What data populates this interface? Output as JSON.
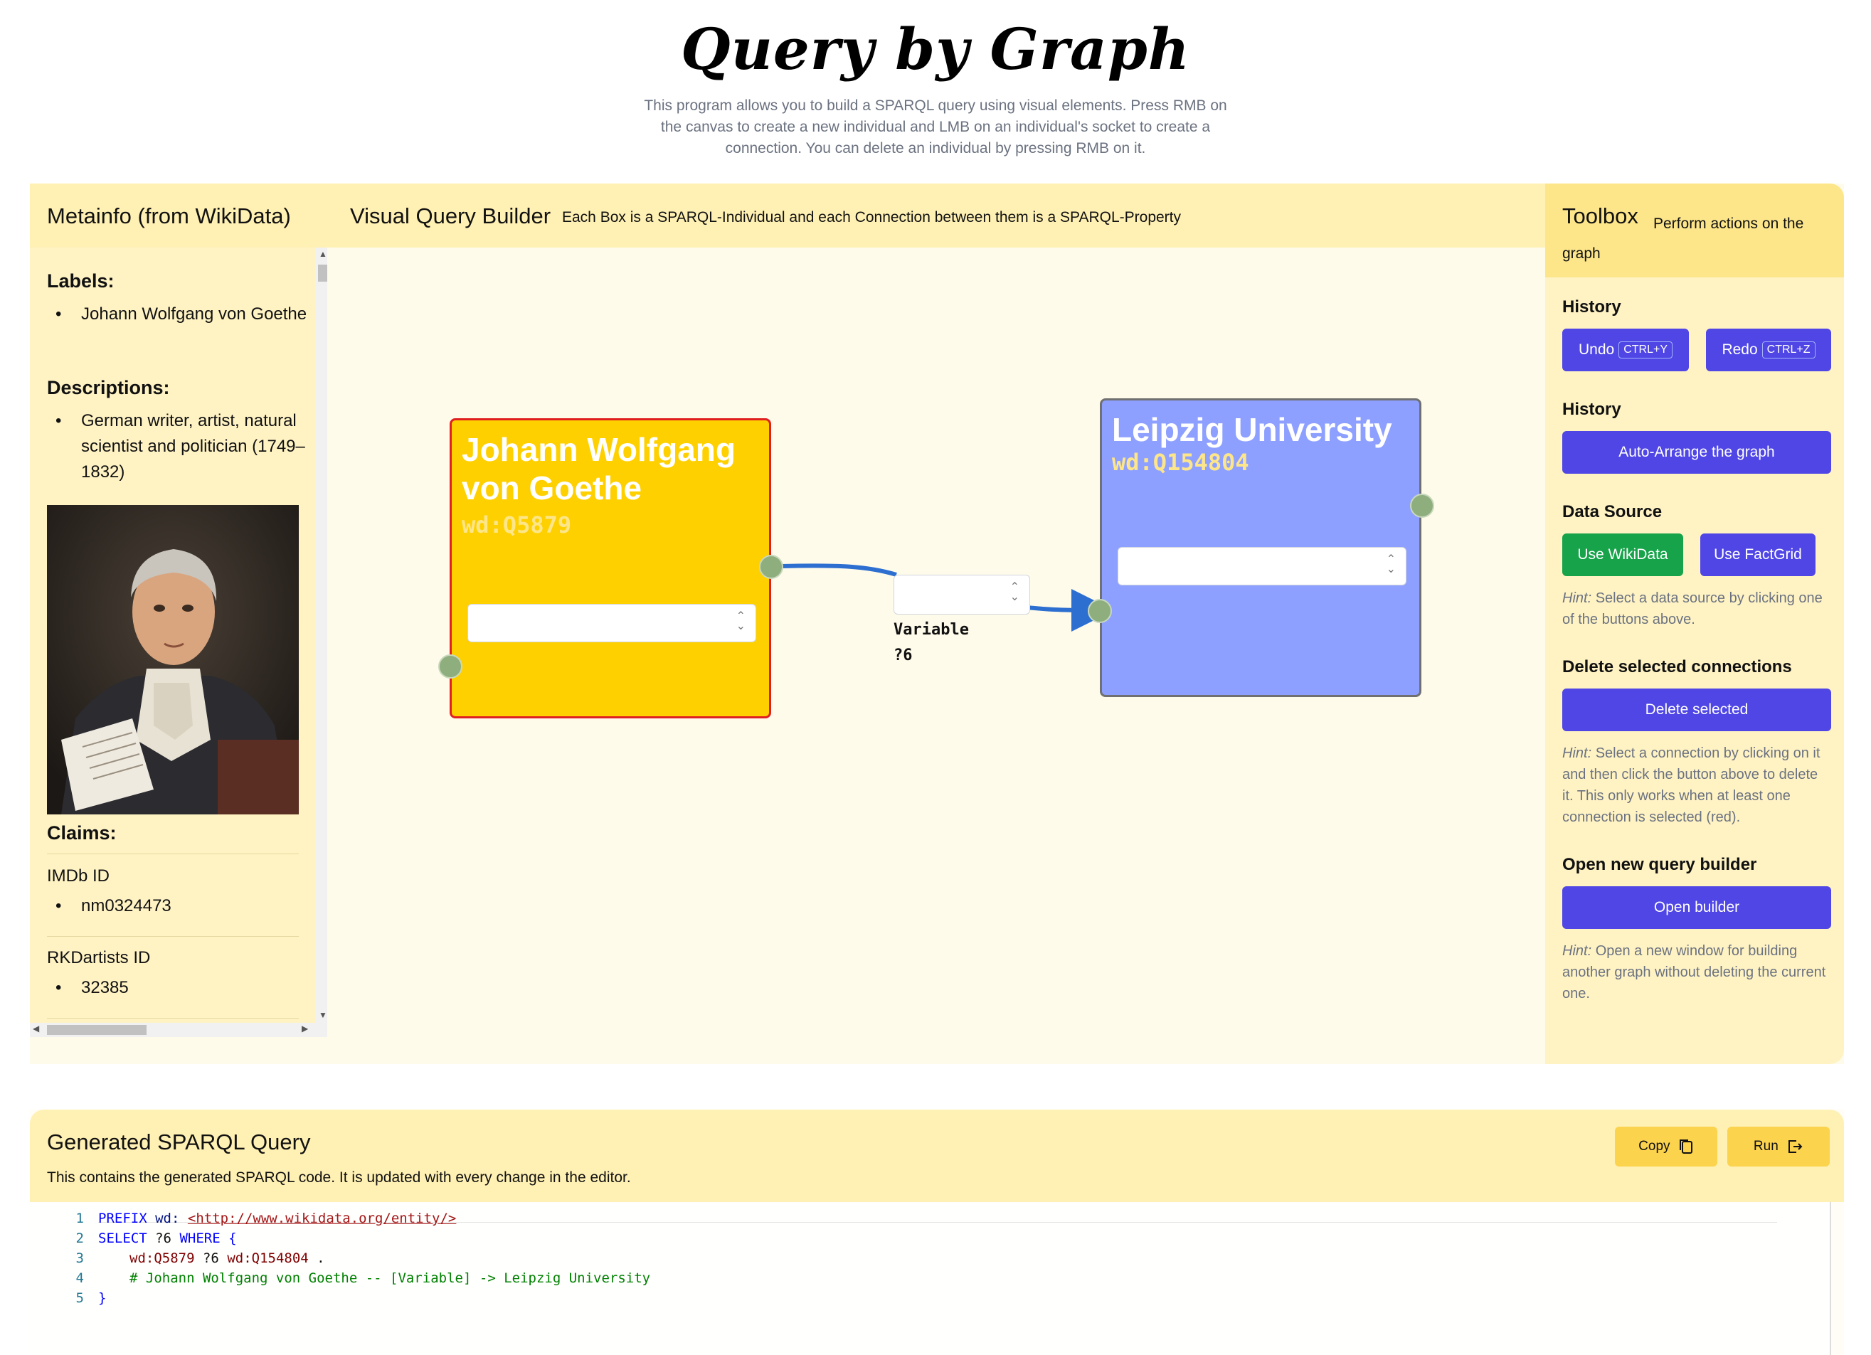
{
  "header": {
    "title": "Query by Graph",
    "intro": "This program allows you to build a SPARQL query using visual elements. Press RMB on the canvas to create a new individual and LMB on an individual's socket to create a connection. You can delete an individual by pressing RMB on it."
  },
  "metainfo": {
    "title": "Metainfo (from WikiData)",
    "labels_heading": "Labels:",
    "label": "Johann Wolfgang von Goethe",
    "descriptions_heading": "Descriptions:",
    "description": "German writer, artist, natural scientist and politician (1749–1832)",
    "claims_heading": "Claims:",
    "claims": [
      {
        "name": "IMDb ID",
        "value": "nm0324473"
      },
      {
        "name": "RKDartists ID",
        "value": "32385"
      }
    ]
  },
  "builder": {
    "title": "Visual Query Builder",
    "subtitle": "Each Box is a SPARQL-Individual and each Connection between them is a SPARQL-Property",
    "nodes": [
      {
        "title": "Johann Wolfgang von Goethe",
        "id": "wd:Q5879",
        "color": "#ffd000",
        "border": "#e02020"
      },
      {
        "title": "Leipzig University",
        "id": "wd:Q154804",
        "color": "#8ea0ff",
        "border": "#707070"
      }
    ],
    "edge": {
      "label_line1": "Variable",
      "label_line2": "?6",
      "color": "#2d6fd0"
    }
  },
  "toolbox": {
    "title": "Toolbox",
    "subtitle": "Perform actions on the graph",
    "history_heading": "History",
    "undo_label": "Undo",
    "undo_shortcut": "CTRL+Y",
    "redo_label": "Redo",
    "redo_shortcut": "CTRL+Z",
    "history2_heading": "History",
    "arrange_label": "Auto-Arrange the graph",
    "datasource_heading": "Data Source",
    "wikidata_label": "Use WikiData",
    "factgrid_label": "Use FactGrid",
    "datasource_hint_prefix": "Hint:",
    "datasource_hint": "Select a data source by clicking one of the buttons above.",
    "delete_heading": "Delete selected connections",
    "delete_label": "Delete selected",
    "delete_hint_prefix": "Hint:",
    "delete_hint": "Select a connection by clicking on it and then click the button above to delete it. This only works when at least one connection is selected (red).",
    "open_heading": "Open new query builder",
    "open_label": "Open builder",
    "open_hint_prefix": "Hint:",
    "open_hint": "Open a new window for building another graph without deleting the current one."
  },
  "sparql": {
    "title": "Generated SPARQL Query",
    "subtitle": "This contains the generated SPARQL code. It is updated with every change in the editor.",
    "copy_label": "Copy",
    "run_label": "Run",
    "line_numbers": [
      "1",
      "2",
      "3",
      "4",
      "5"
    ],
    "line1_kw": "PREFIX",
    "line1_prefix": "wd:",
    "line1_url": "<http://www.wikidata.org/entity/>",
    "line2_kw1": "SELECT",
    "line2_var": "?6",
    "line2_kw2": "WHERE",
    "line2_brace": "{",
    "line3_subject": "wd:Q5879",
    "line3_var": "?6",
    "line3_object": "wd:Q154804",
    "line3_dot": ".",
    "line4_comment": "# Johann Wolfgang von Goethe -- [Variable] -> Leipzig University",
    "line5": "}"
  }
}
